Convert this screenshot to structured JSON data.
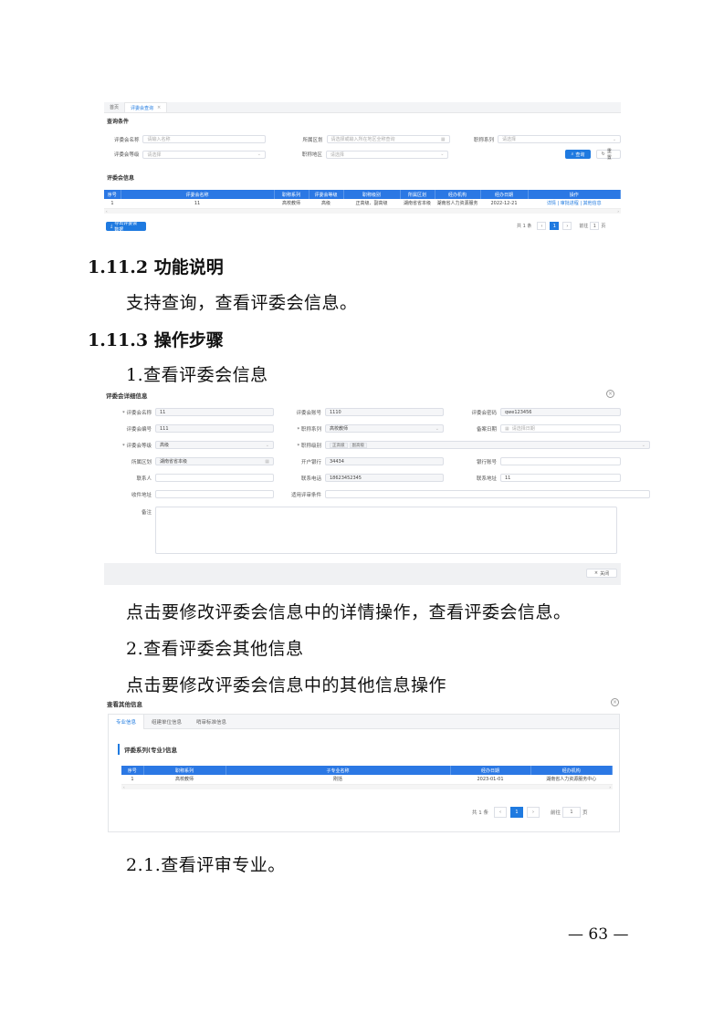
{
  "shot1": {
    "tabs": [
      {
        "label": "首页"
      },
      {
        "label": "评委会查询"
      }
    ],
    "tab_close": "×",
    "query_title": "查询条件",
    "fields": {
      "name_label": "评委会名称",
      "name_ph": "请输入名称",
      "region_label": "所属区划",
      "region_ph": "请选择或输入所在地区全称查询",
      "series_label": "职称系列",
      "series_ph": "请选择",
      "level_label": "评委会等级",
      "level_ph": "请选择",
      "area_label": "职称地区",
      "area_ph": "请选择"
    },
    "search_btn": "查询",
    "reset_btn": "重置",
    "info_title": "评委会信息",
    "table_headers": [
      "序号",
      "评委会名称",
      "职称系列",
      "评委会等级",
      "职称级别",
      "所属区划",
      "经办机构",
      "经办日期",
      "操作"
    ],
    "table_rows": [
      [
        "1",
        "11",
        "高校教师",
        "高级",
        "正高级、副高级",
        "湖南省省本级",
        "湖南省人力资源服务",
        "2022-12-21"
      ]
    ],
    "row_actions": [
      "详情",
      "审批进程",
      "其他信息"
    ],
    "export_btn": "导出评委会数据",
    "pager": {
      "total": "共 1 条",
      "page": "1",
      "goto": "前往",
      "goto_val": "1",
      "unit": "页"
    }
  },
  "sec_1_11_2": {
    "heading": "1.11.2 功能说明",
    "text": "支持查询，查看评委会信息。"
  },
  "sec_1_11_3": {
    "heading": "1.11.3 操作步骤",
    "step1": "1.查看评委会信息"
  },
  "shot2": {
    "title": "评委会详细信息",
    "r1": {
      "l1": "* 评委会名称",
      "v1": "11",
      "l2": "评委会账号",
      "v2": "1110",
      "l3": "评委会密码",
      "v3": "qwe123456"
    },
    "r2": {
      "l1": "评委会编号",
      "v1": "111",
      "l2": "* 职称系列",
      "v2": "高校教师",
      "l3": "备案日期",
      "v3": "请选择日期"
    },
    "r3": {
      "l1": "* 评委会等级",
      "v1": "高级",
      "l2": "* 职称级别",
      "tags": [
        "正高级",
        "副高级"
      ]
    },
    "r4": {
      "l1": "所属区划",
      "v1": "湖南省省本级",
      "l2": "开户银行",
      "v2": "34434",
      "l3": "银行账号",
      "v3": ""
    },
    "r5": {
      "l1": "联系人",
      "v1": "",
      "l2": "联系电话",
      "v2": "18623452345",
      "l3": "联系地址",
      "v3": "11"
    },
    "r6": {
      "l1": "收件地址",
      "v1": "",
      "l2": "适用评审条件",
      "v2": ""
    },
    "remark_label": "备注",
    "close_btn": "关闭"
  },
  "para1": "点击要修改评委会信息中的详情操作，查看评委会信息。",
  "step2": "2.查看评委会其他信息",
  "para2": "点击要修改评委会信息中的其他信息操作",
  "shot3": {
    "title": "查看其他信息",
    "tabs": [
      {
        "label": "专业信息"
      },
      {
        "label": "组建单位信息"
      },
      {
        "label": "哨审标准信息"
      }
    ],
    "section_title": "评委系列(专业)信息",
    "table_headers": [
      "序号",
      "职称系列",
      "子专业名称",
      "经办日期",
      "经办机构"
    ],
    "table_rows": [
      [
        "1",
        "高校教师",
        "刚括",
        "2023-01-01",
        "湖南省人力资源服务中心"
      ]
    ],
    "pager": {
      "total": "共 1 条",
      "page": "1",
      "goto": "前往",
      "goto_val": "1",
      "unit": "页"
    }
  },
  "step2_1": "2.1.查看评审专业。",
  "page_number": "— 63 —",
  "colors": {
    "primary": "#1f7ae0",
    "header_blue": "#2b78e4"
  },
  "icons": {
    "search": "search-icon",
    "reset": "refresh-icon",
    "close": "close-circle-icon",
    "calendar": "calendar-icon"
  }
}
